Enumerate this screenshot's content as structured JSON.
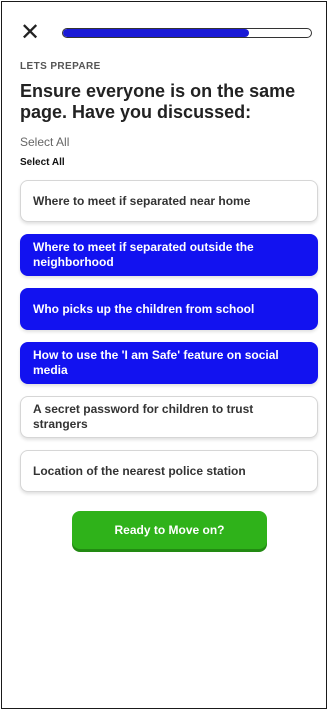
{
  "header": {
    "close_icon": "close-icon",
    "progress": 0.75
  },
  "eyebrow": "LETS PREPARE",
  "heading": "Ensure everyone is on the same page. Have you discussed:",
  "select_all_text": "Select All",
  "select_all_bold": "Select All",
  "options": [
    {
      "label": "Where to meet if separated near home",
      "selected": false
    },
    {
      "label": "Where to meet if separated outside the neighborhood",
      "selected": true
    },
    {
      "label": "Who picks up the children from school",
      "selected": true
    },
    {
      "label": "How to use the 'I am Safe' feature on social media",
      "selected": true
    },
    {
      "label": "A secret password for children to trust strangers",
      "selected": false
    },
    {
      "label": "Location of the nearest police station",
      "selected": false
    }
  ],
  "cta_label": "Ready to Move on?",
  "colors": {
    "selected": "#1212f0",
    "cta": "#2fb21a",
    "progress": "#1a1ad6"
  }
}
